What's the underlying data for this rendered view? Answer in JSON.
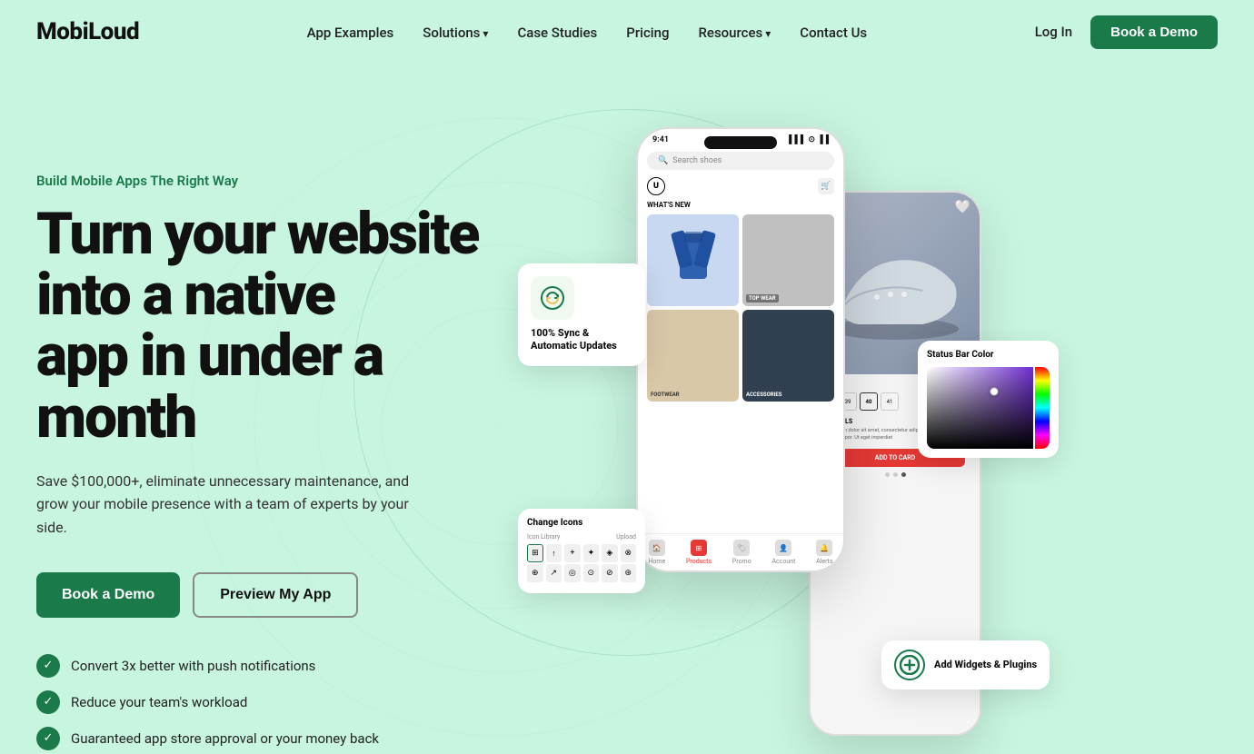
{
  "nav": {
    "logo": "MobiLoud",
    "links": [
      {
        "label": "App Examples",
        "has_arrow": false
      },
      {
        "label": "Solutions",
        "has_arrow": true
      },
      {
        "label": "Case Studies",
        "has_arrow": false
      },
      {
        "label": "Pricing",
        "has_arrow": false
      },
      {
        "label": "Resources",
        "has_arrow": true
      },
      {
        "label": "Contact Us",
        "has_arrow": false
      }
    ],
    "login_label": "Log In",
    "book_demo_label": "Book a Demo"
  },
  "hero": {
    "tagline": "Build Mobile Apps The Right Way",
    "title_line1": "Turn your website into a native",
    "title_line2": "app in under a month",
    "subtitle": "Save $100,000+, eliminate unnecessary maintenance, and grow your mobile presence with a team of experts by your side.",
    "btn_primary": "Book a Demo",
    "btn_secondary": "Preview My App",
    "checks": [
      "Convert 3x better with push notifications",
      "Reduce your team's workload",
      "Guaranteed app store approval or your money back"
    ]
  },
  "phone_main": {
    "time": "9:41",
    "search_placeholder": "Search shoes",
    "whats_new": "WHAT'S NEW",
    "top_wear": "TOP WEAR",
    "footwear": "FOOTWEAR",
    "accessories": "ACCESSORIES",
    "bottom_nav": [
      "Home",
      "Products",
      "Promo",
      "Account",
      "Alerts"
    ]
  },
  "float_cards": {
    "sync": {
      "title": "100% Sync & Automatic Updates",
      "icon": "⟳"
    },
    "status_bar": {
      "title": "Status Bar Color"
    },
    "change_icons": {
      "title": "Change Icons"
    },
    "add_widgets": {
      "title": "Add Widgets & Plugins"
    }
  },
  "colors": {
    "brand_green": "#1a7a4a",
    "bg": "#c8f5e0",
    "accent_red": "#e53935"
  }
}
